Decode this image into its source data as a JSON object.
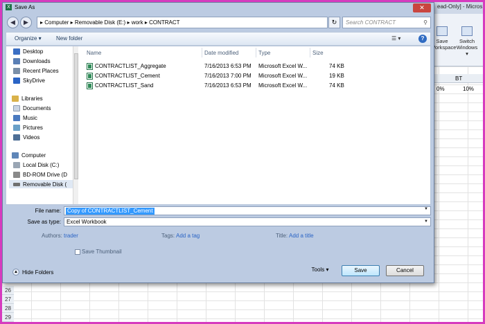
{
  "window": {
    "title": "Save As",
    "close_symbol": "✕",
    "app_icon": "X"
  },
  "background": {
    "excel_title_fragment": "ead-Only] - Micros",
    "ribbon": {
      "save_workspace": "Save Workspace",
      "switch_windows": "Switch Windows ▾"
    },
    "column_header": "BT",
    "cells": [
      "0%",
      "10%"
    ],
    "row_numbers": [
      "26",
      "27",
      "28",
      "29"
    ]
  },
  "address_bar": {
    "back_icon": "◀",
    "forward_icon": "▶",
    "breadcrumb": [
      "Computer",
      "Removable Disk (E:)",
      "work",
      "CONTRACT"
    ],
    "separator": "▸",
    "dropdown_icon": "▼",
    "refresh_icon": "↻"
  },
  "search": {
    "placeholder": "Search CONTRACT",
    "icon": "⚲"
  },
  "toolbar": {
    "organize": "Organize ▾",
    "new_folder": "New folder",
    "view_icon": "☰ ▾",
    "help_icon": "?"
  },
  "nav_pane": {
    "items": [
      {
        "label": "Desktop",
        "icon": "desktop-icon",
        "color": "#3b6fc4"
      },
      {
        "label": "Downloads",
        "icon": "downloads-icon",
        "color": "#5a7fb5"
      },
      {
        "label": "Recent Places",
        "icon": "recent-places-icon",
        "color": "#7a8fa8"
      },
      {
        "label": "SkyDrive",
        "icon": "skydrive-icon",
        "color": "#2a64c5"
      },
      {
        "label": "Libraries",
        "icon": "libraries-icon",
        "color": "#d9b24a"
      },
      {
        "label": "Documents",
        "icon": "documents-icon",
        "color": "#c9d4e2"
      },
      {
        "label": "Music",
        "icon": "music-icon",
        "color": "#4a7ac0"
      },
      {
        "label": "Pictures",
        "icon": "pictures-icon",
        "color": "#6aa0c8"
      },
      {
        "label": "Videos",
        "icon": "videos-icon",
        "color": "#4e6f96"
      },
      {
        "label": "Computer",
        "icon": "computer-icon",
        "color": "#5f86b8"
      },
      {
        "label": "Local Disk (C:)",
        "icon": "local-disk-icon",
        "color": "#9aa6b4"
      },
      {
        "label": "BD-ROM Drive (D",
        "icon": "bd-rom-icon",
        "color": "#8a8a8a"
      },
      {
        "label": "Removable Disk (",
        "icon": "removable-disk-icon",
        "color": "#707070"
      }
    ]
  },
  "file_list": {
    "columns": [
      "Name",
      "Date modified",
      "Type",
      "Size"
    ],
    "rows": [
      {
        "name": "CONTRACTLIST_Aggregate",
        "date": "7/16/2013 6:53 PM",
        "type": "Microsoft Excel W...",
        "size": "74 KB"
      },
      {
        "name": "CONTRACTLIST_Cement",
        "date": "7/16/2013 7:00 PM",
        "type": "Microsoft Excel W...",
        "size": "19 KB"
      },
      {
        "name": "CONTRACTLIST_Sand",
        "date": "7/16/2013 6:53 PM",
        "type": "Microsoft Excel W...",
        "size": "74 KB"
      }
    ]
  },
  "form": {
    "file_name_label": "File name:",
    "file_name_value": "Copy of CONTRACTLIST_Cement",
    "save_type_label": "Save as type:",
    "save_type_value": "Excel Workbook",
    "authors_label": "Authors:",
    "authors_value": "trader",
    "tags_label": "Tags:",
    "tags_value": "Add a tag",
    "title_label": "Title:",
    "title_value": "Add a title",
    "save_thumbnail": "Save Thumbnail",
    "dropdown_icon": "▼"
  },
  "footer": {
    "hide_folders": "Hide Folders",
    "hide_icon": "▲",
    "tools": "Tools",
    "tools_arrow": "▾",
    "save": "Save",
    "cancel": "Cancel"
  }
}
